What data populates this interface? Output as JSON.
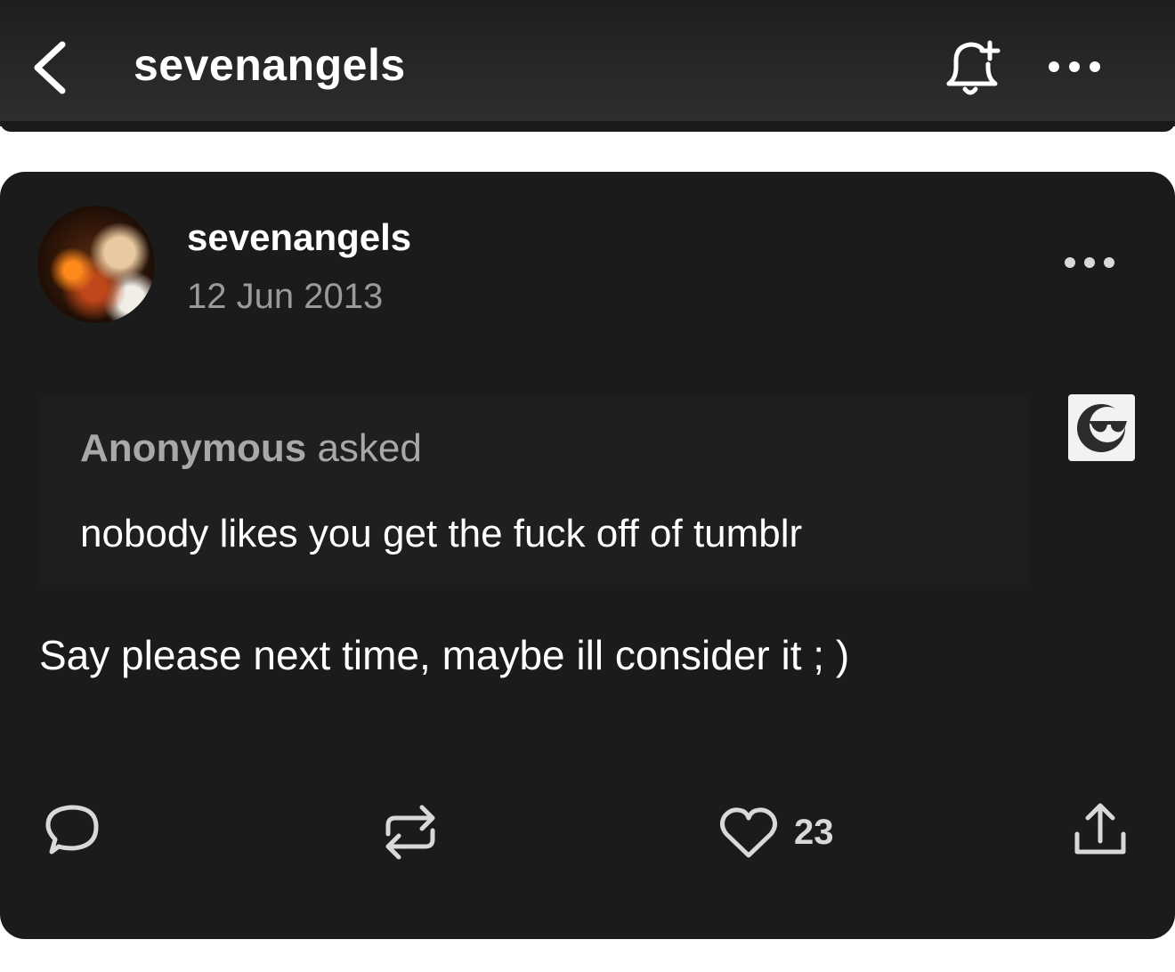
{
  "header": {
    "title": "sevenangels",
    "icons": [
      "back-icon",
      "bell-plus-icon",
      "more-icon"
    ]
  },
  "post": {
    "author": "sevenangels",
    "date": "12 Jun 2013",
    "ask": {
      "asker": "Anonymous",
      "verb": " asked",
      "question": "nobody likes you get the fuck off of tumblr"
    },
    "answer": "Say please next time, maybe ill consider it ; )",
    "actions": {
      "icons": [
        "reply-icon",
        "reblog-icon",
        "heart-icon",
        "share-icon"
      ],
      "like_count": "23"
    }
  },
  "colors": {
    "background": "#1b1b1b",
    "header": "#2a2a2a",
    "text": "#ffffff",
    "muted": "#9a9a9a"
  }
}
